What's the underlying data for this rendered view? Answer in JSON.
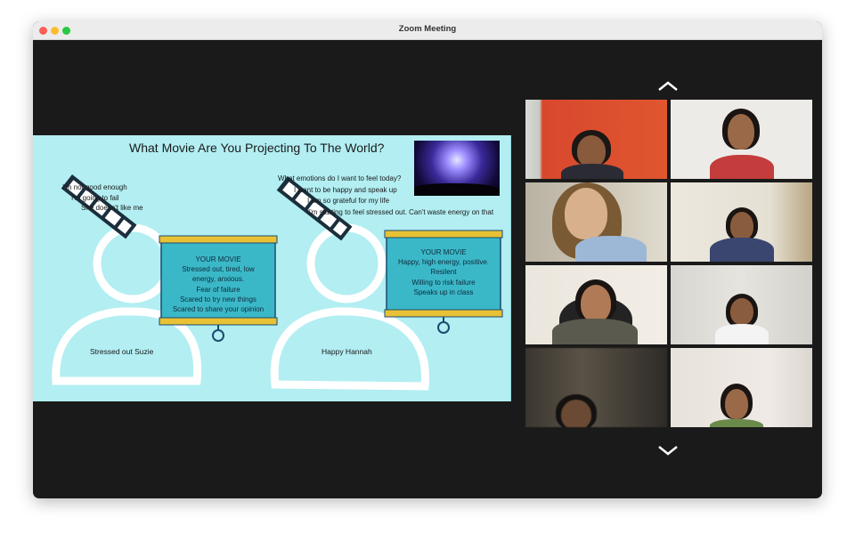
{
  "window": {
    "title": "Zoom Meeting"
  },
  "slide": {
    "title": "What Movie Are You Projecting To The World?",
    "negative_thoughts": [
      "I'm not good enough",
      "I'm going to fail",
      "She doesn't like me"
    ],
    "positive_thoughts": [
      "What emotions do I want to feel today?",
      "I want to be happy and speak up",
      "I am so grateful for my life",
      "I'm starting to feel stressed out. Can't waste energy on that"
    ],
    "left_movie": {
      "heading": "YOUR MOVIE",
      "lines": [
        "Stressed out, tired, low",
        "energy, anxious.",
        "Fear of failure",
        "Scared to try new things",
        "Scared to share your opinion"
      ]
    },
    "right_movie": {
      "heading": "YOUR MOVIE",
      "lines": [
        "Happy, high energy, positive.",
        "Resilent",
        "Willing to risk failure",
        "Speaks up in class"
      ]
    },
    "left_person": "Stressed out Suzie",
    "right_person": "Happy Hannah"
  },
  "colors": {
    "slide_bg": "#b2eef2",
    "screen_fill": "#3bb8c8",
    "screen_bar": "#e8c234",
    "screen_border": "#1b4b6e",
    "window_bg": "#1a1a1a"
  },
  "icons": {
    "scroll_up": "chevron-up-icon",
    "scroll_down": "chevron-down-icon",
    "film_strip": "film-strip-icon"
  },
  "participants": [
    {
      "position": "row1-left"
    },
    {
      "position": "row1-right"
    },
    {
      "position": "row2-left"
    },
    {
      "position": "row2-right"
    },
    {
      "position": "row3-left"
    },
    {
      "position": "row3-right"
    },
    {
      "position": "row4-left"
    },
    {
      "position": "row4-right"
    }
  ]
}
